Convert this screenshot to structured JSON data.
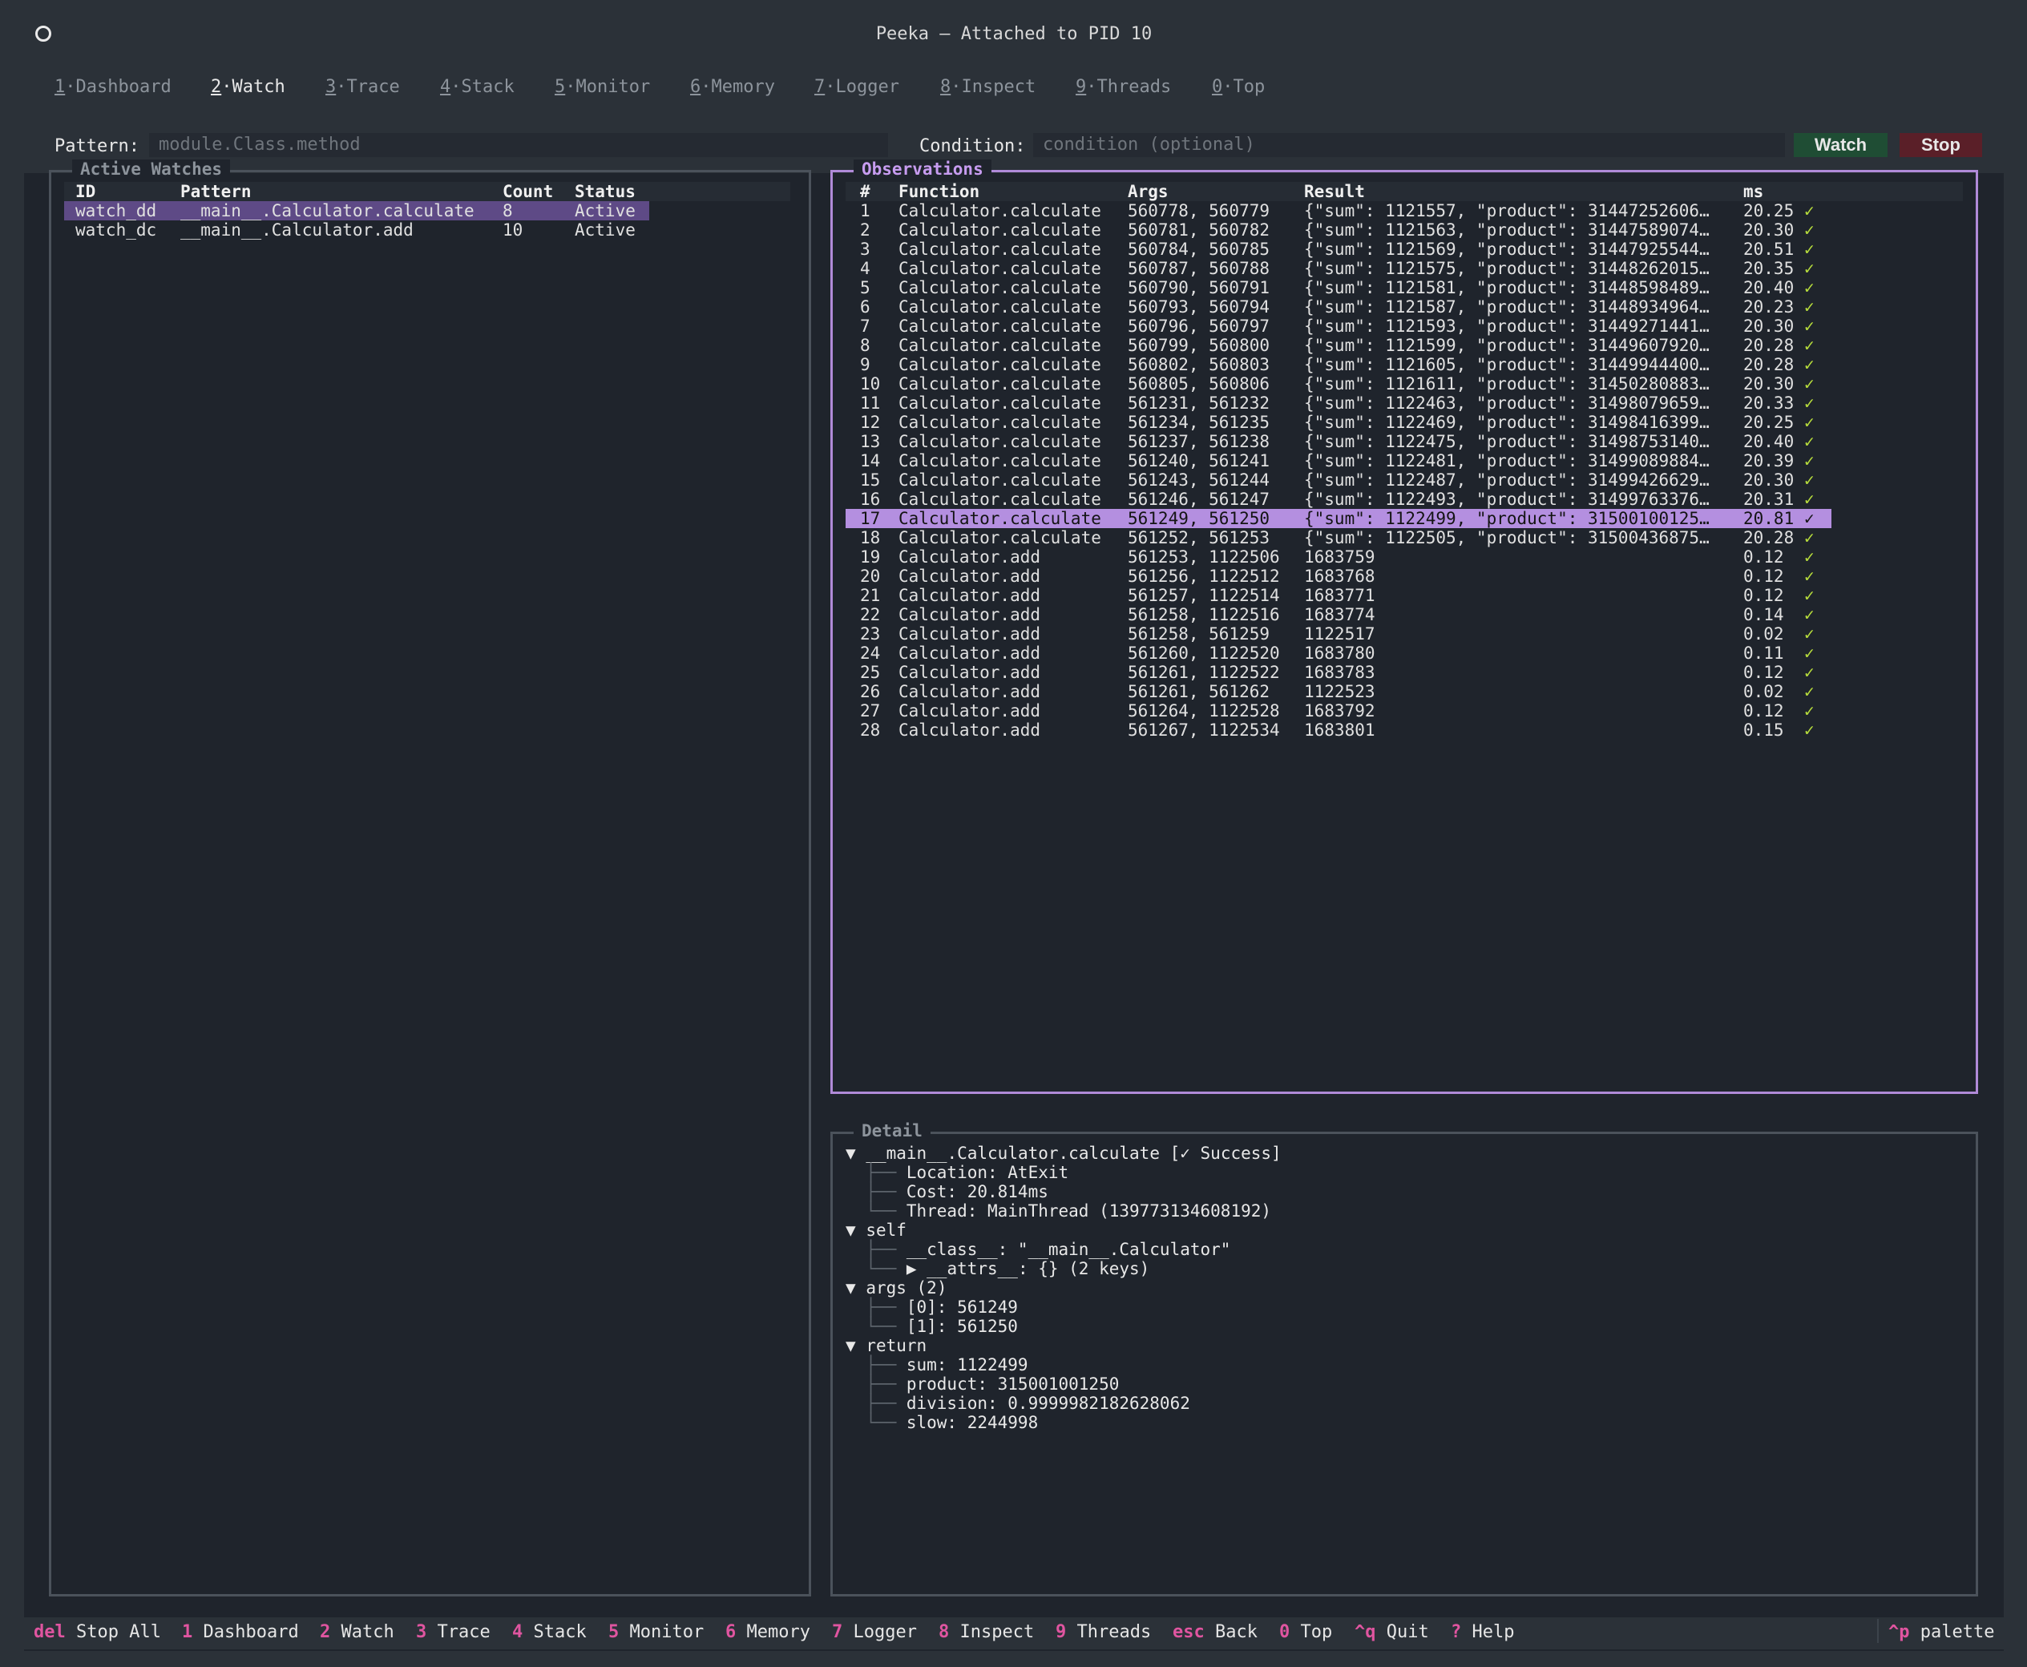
{
  "window": {
    "title": "Peeka — Attached to PID 10"
  },
  "tabs": [
    {
      "num": "1",
      "label": "Dashboard"
    },
    {
      "num": "2",
      "label": "Watch"
    },
    {
      "num": "3",
      "label": "Trace"
    },
    {
      "num": "4",
      "label": "Stack"
    },
    {
      "num": "5",
      "label": "Monitor"
    },
    {
      "num": "6",
      "label": "Memory"
    },
    {
      "num": "7",
      "label": "Logger"
    },
    {
      "num": "8",
      "label": "Inspect"
    },
    {
      "num": "9",
      "label": "Threads"
    },
    {
      "num": "0",
      "label": "Top"
    }
  ],
  "active_tab": "Watch",
  "form": {
    "pattern_label": "Pattern:",
    "pattern_placeholder": "module.Class.method",
    "condition_label": "Condition:",
    "condition_placeholder": "condition (optional)",
    "watch_button": "Watch",
    "stop_button": "Stop"
  },
  "active_watches": {
    "title": "Active Watches",
    "headers": {
      "id": "ID",
      "pattern": "Pattern",
      "count": "Count",
      "status": "Status"
    },
    "rows": [
      {
        "id": "watch_dd",
        "pattern": "__main__.Calculator.calculate",
        "count": "8",
        "status": "Active",
        "selected": true
      },
      {
        "id": "watch_dc",
        "pattern": "__main__.Calculator.add",
        "count": "10",
        "status": "Active",
        "selected": false
      }
    ]
  },
  "observations": {
    "title": "Observations",
    "headers": {
      "num": "#",
      "func": "Function",
      "args": "Args",
      "result": "Result",
      "ms": "ms"
    },
    "highlighted_index": 17,
    "rows": [
      {
        "n": "1",
        "f": "Calculator.calculate",
        "a": "560778, 560779",
        "r": "{\"sum\": 1121557, \"product\": 31447252606…",
        "ms": "20.25",
        "s": "✓"
      },
      {
        "n": "2",
        "f": "Calculator.calculate",
        "a": "560781, 560782",
        "r": "{\"sum\": 1121563, \"product\": 31447589074…",
        "ms": "20.30",
        "s": "✓"
      },
      {
        "n": "3",
        "f": "Calculator.calculate",
        "a": "560784, 560785",
        "r": "{\"sum\": 1121569, \"product\": 31447925544…",
        "ms": "20.51",
        "s": "✓"
      },
      {
        "n": "4",
        "f": "Calculator.calculate",
        "a": "560787, 560788",
        "r": "{\"sum\": 1121575, \"product\": 31448262015…",
        "ms": "20.35",
        "s": "✓"
      },
      {
        "n": "5",
        "f": "Calculator.calculate",
        "a": "560790, 560791",
        "r": "{\"sum\": 1121581, \"product\": 31448598489…",
        "ms": "20.40",
        "s": "✓"
      },
      {
        "n": "6",
        "f": "Calculator.calculate",
        "a": "560793, 560794",
        "r": "{\"sum\": 1121587, \"product\": 31448934964…",
        "ms": "20.23",
        "s": "✓"
      },
      {
        "n": "7",
        "f": "Calculator.calculate",
        "a": "560796, 560797",
        "r": "{\"sum\": 1121593, \"product\": 31449271441…",
        "ms": "20.30",
        "s": "✓"
      },
      {
        "n": "8",
        "f": "Calculator.calculate",
        "a": "560799, 560800",
        "r": "{\"sum\": 1121599, \"product\": 31449607920…",
        "ms": "20.28",
        "s": "✓"
      },
      {
        "n": "9",
        "f": "Calculator.calculate",
        "a": "560802, 560803",
        "r": "{\"sum\": 1121605, \"product\": 31449944400…",
        "ms": "20.28",
        "s": "✓"
      },
      {
        "n": "10",
        "f": "Calculator.calculate",
        "a": "560805, 560806",
        "r": "{\"sum\": 1121611, \"product\": 31450280883…",
        "ms": "20.30",
        "s": "✓"
      },
      {
        "n": "11",
        "f": "Calculator.calculate",
        "a": "561231, 561232",
        "r": "{\"sum\": 1122463, \"product\": 31498079659…",
        "ms": "20.33",
        "s": "✓"
      },
      {
        "n": "12",
        "f": "Calculator.calculate",
        "a": "561234, 561235",
        "r": "{\"sum\": 1122469, \"product\": 31498416399…",
        "ms": "20.25",
        "s": "✓"
      },
      {
        "n": "13",
        "f": "Calculator.calculate",
        "a": "561237, 561238",
        "r": "{\"sum\": 1122475, \"product\": 31498753140…",
        "ms": "20.40",
        "s": "✓"
      },
      {
        "n": "14",
        "f": "Calculator.calculate",
        "a": "561240, 561241",
        "r": "{\"sum\": 1122481, \"product\": 31499089884…",
        "ms": "20.39",
        "s": "✓"
      },
      {
        "n": "15",
        "f": "Calculator.calculate",
        "a": "561243, 561244",
        "r": "{\"sum\": 1122487, \"product\": 31499426629…",
        "ms": "20.30",
        "s": "✓"
      },
      {
        "n": "16",
        "f": "Calculator.calculate",
        "a": "561246, 561247",
        "r": "{\"sum\": 1122493, \"product\": 31499763376…",
        "ms": "20.31",
        "s": "✓"
      },
      {
        "n": "17",
        "f": "Calculator.calculate",
        "a": "561249, 561250",
        "r": "{\"sum\": 1122499, \"product\": 31500100125…",
        "ms": "20.81",
        "s": "✓"
      },
      {
        "n": "18",
        "f": "Calculator.calculate",
        "a": "561252, 561253",
        "r": "{\"sum\": 1122505, \"product\": 31500436875…",
        "ms": "20.28",
        "s": "✓"
      },
      {
        "n": "19",
        "f": "Calculator.add",
        "a": "561253, 1122506",
        "r": "1683759",
        "ms": "0.12",
        "s": "✓"
      },
      {
        "n": "20",
        "f": "Calculator.add",
        "a": "561256, 1122512",
        "r": "1683768",
        "ms": "0.12",
        "s": "✓"
      },
      {
        "n": "21",
        "f": "Calculator.add",
        "a": "561257, 1122514",
        "r": "1683771",
        "ms": "0.12",
        "s": "✓"
      },
      {
        "n": "22",
        "f": "Calculator.add",
        "a": "561258, 1122516",
        "r": "1683774",
        "ms": "0.14",
        "s": "✓"
      },
      {
        "n": "23",
        "f": "Calculator.add",
        "a": "561258, 561259",
        "r": "1122517",
        "ms": "0.02",
        "s": "✓"
      },
      {
        "n": "24",
        "f": "Calculator.add",
        "a": "561260, 1122520",
        "r": "1683780",
        "ms": "0.11",
        "s": "✓"
      },
      {
        "n": "25",
        "f": "Calculator.add",
        "a": "561261, 1122522",
        "r": "1683783",
        "ms": "0.12",
        "s": "✓"
      },
      {
        "n": "26",
        "f": "Calculator.add",
        "a": "561261, 561262",
        "r": "1122523",
        "ms": "0.02",
        "s": "✓"
      },
      {
        "n": "27",
        "f": "Calculator.add",
        "a": "561264, 1122528",
        "r": "1683792",
        "ms": "0.12",
        "s": "✓"
      },
      {
        "n": "28",
        "f": "Calculator.add",
        "a": "561267, 1122534",
        "r": "1683801",
        "ms": "0.15",
        "s": "✓"
      }
    ]
  },
  "detail": {
    "title": "Detail",
    "lines": [
      {
        "arrow": "▼",
        "guide": "",
        "text": "__main__.Calculator.calculate [✓ Success]"
      },
      {
        "arrow": "",
        "guide": "├── ",
        "text": "Location: AtExit"
      },
      {
        "arrow": "",
        "guide": "├── ",
        "text": "Cost: 20.814ms"
      },
      {
        "arrow": "",
        "guide": "└── ",
        "text": "Thread: MainThread (139773134608192)"
      },
      {
        "arrow": "▼",
        "guide": "",
        "text": "self"
      },
      {
        "arrow": "",
        "guide": "├── ",
        "text": "__class__: \"__main__.Calculator\""
      },
      {
        "arrow": "",
        "guide": "└── ▶ ",
        "text": "__attrs__: {} (2 keys)"
      },
      {
        "arrow": "▼",
        "guide": "",
        "text": "args (2)"
      },
      {
        "arrow": "",
        "guide": "├── ",
        "text": "[0]: 561249"
      },
      {
        "arrow": "",
        "guide": "└── ",
        "text": "[1]: 561250"
      },
      {
        "arrow": "▼",
        "guide": "",
        "text": "return"
      },
      {
        "arrow": "",
        "guide": "├── ",
        "text": "sum: 1122499"
      },
      {
        "arrow": "",
        "guide": "├── ",
        "text": "product: 315001001250"
      },
      {
        "arrow": "",
        "guide": "├── ",
        "text": "division: 0.9999982182628062"
      },
      {
        "arrow": "",
        "guide": "└── ",
        "text": "slow: 2244998"
      }
    ]
  },
  "footer": {
    "items": [
      {
        "key": "del",
        "label": "Stop All"
      },
      {
        "key": "1",
        "label": "Dashboard"
      },
      {
        "key": "2",
        "label": "Watch"
      },
      {
        "key": "3",
        "label": "Trace"
      },
      {
        "key": "4",
        "label": "Stack"
      },
      {
        "key": "5",
        "label": "Monitor"
      },
      {
        "key": "6",
        "label": "Memory"
      },
      {
        "key": "7",
        "label": "Logger"
      },
      {
        "key": "8",
        "label": "Inspect"
      },
      {
        "key": "9",
        "label": "Threads"
      },
      {
        "key": "esc",
        "label": "Back"
      },
      {
        "key": "0",
        "label": "Top"
      },
      {
        "key": "^q",
        "label": "Quit"
      },
      {
        "key": "?",
        "label": "Help"
      }
    ],
    "palette": {
      "key": "^p",
      "label": "palette"
    }
  },
  "colors": {
    "accent": "#b08ad8",
    "highlight": "#b48fe0",
    "selected_row": "#5e4a86",
    "success": "#b7dd3c",
    "footer_key": "#e055a0",
    "watch_button_bg": "#1f4d34",
    "stop_button_bg": "#5a1f28"
  },
  "icons": {
    "window_control": "circle-icon",
    "success": "check-icon",
    "expanded": "triangle-down-icon",
    "collapsed": "triangle-right-icon"
  }
}
